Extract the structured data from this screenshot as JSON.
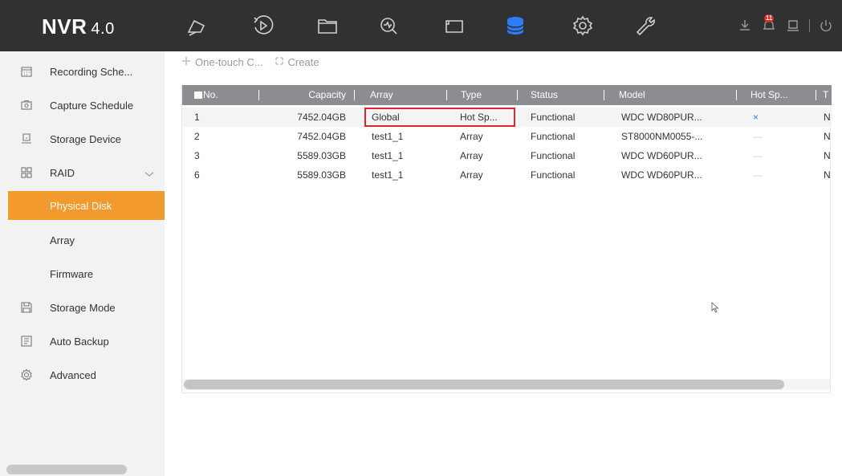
{
  "header": {
    "logo_main": "NVR",
    "logo_version": "4.0",
    "nav_icons": [
      "live-view-icon",
      "playback-icon",
      "file-management-icon",
      "smart-analysis-icon",
      "camera-icon",
      "storage-icon",
      "configuration-icon",
      "maintenance-icon"
    ],
    "notification_count": "11"
  },
  "sidebar": {
    "items": [
      {
        "label": "Recording Sche...",
        "icon": "calendar-icon"
      },
      {
        "label": "Capture Schedule",
        "icon": "camera-icon"
      },
      {
        "label": "Storage Device",
        "icon": "hdd-icon"
      },
      {
        "label": "RAID",
        "icon": "grid-icon"
      },
      {
        "label": "Physical Disk"
      },
      {
        "label": "Array"
      },
      {
        "label": "Firmware"
      },
      {
        "label": "Storage Mode",
        "icon": "save-icon"
      },
      {
        "label": "Auto Backup",
        "icon": "document-icon"
      },
      {
        "label": "Advanced",
        "icon": "gear-icon"
      }
    ]
  },
  "toolbar": {
    "one_touch_label": "One-touch C...",
    "create_label": "Create"
  },
  "table": {
    "headers": {
      "no": "No.",
      "capacity": "Capacity",
      "array": "Array",
      "type": "Type",
      "status": "Status",
      "model": "Model",
      "hot_spare": "Hot Sp...",
      "t": "T"
    },
    "rows": [
      {
        "no": "1",
        "capacity": "7452.04GB",
        "array": "Global",
        "type": "Hot Sp...",
        "status": "Functional",
        "model": "WDC WD80PUR...",
        "hot_spare": "×",
        "t": "N"
      },
      {
        "no": "2",
        "capacity": "7452.04GB",
        "array": "test1_1",
        "type": "Array",
        "status": "Functional",
        "model": "ST8000NM0055-...",
        "hot_spare": "—",
        "t": "N"
      },
      {
        "no": "3",
        "capacity": "5589.03GB",
        "array": "test1_1",
        "type": "Array",
        "status": "Functional",
        "model": "WDC WD60PUR...",
        "hot_spare": "—",
        "t": "N"
      },
      {
        "no": "6",
        "capacity": "5589.03GB",
        "array": "test1_1",
        "type": "Array",
        "status": "Functional",
        "model": "WDC WD60PUR...",
        "hot_spare": "—",
        "t": "N"
      }
    ]
  },
  "colors": {
    "topbar": "#2f3133",
    "accent": "#f39a2e",
    "table_header": "#8b8d90",
    "highlight_border": "#e0262d",
    "storage_icon": "#2e7cf6"
  }
}
